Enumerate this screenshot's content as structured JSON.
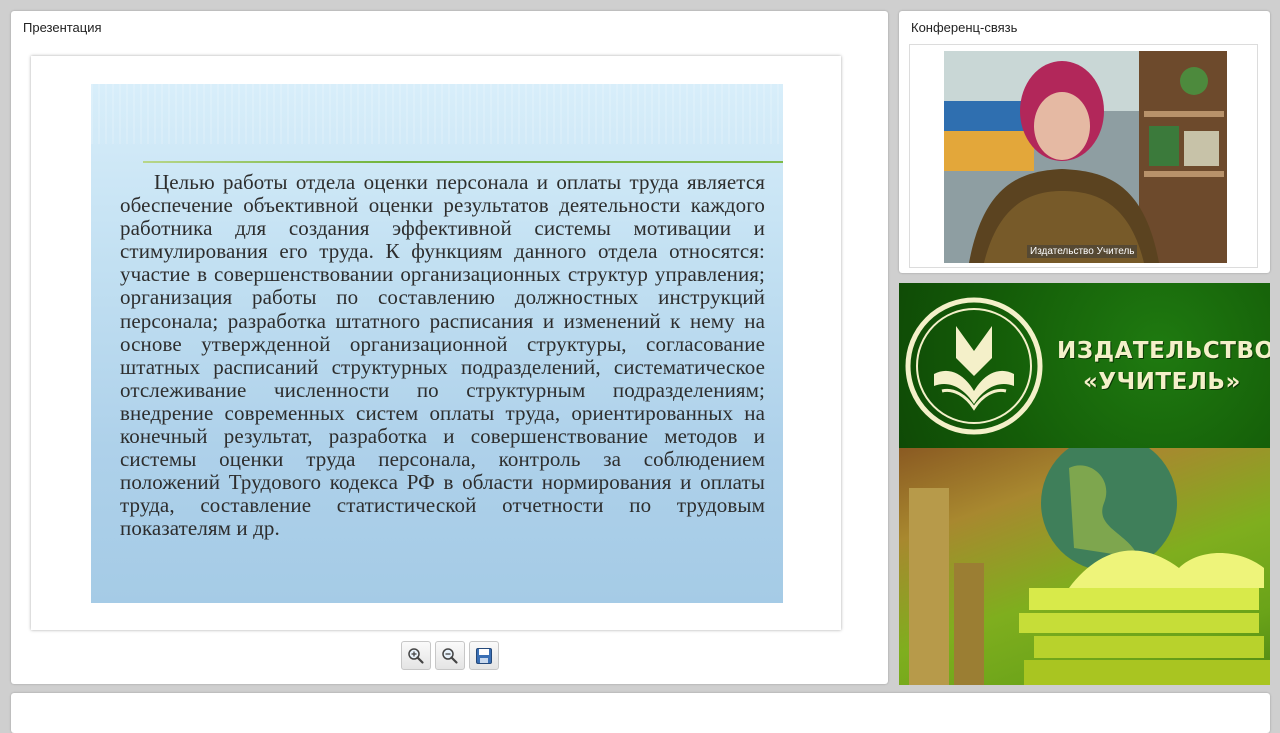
{
  "presentation": {
    "title": "Презентация",
    "slide_text": "Целью работы отдела оценки персонала и оплаты труда является обеспечение объективной оценки результатов деятельности каждого работника для создания эффективной системы мотивации и стимулирования его труда. К функциям данного отдела относятся: участие в совершенствовании организационных структур управления; организация работы по составлению должностных инструкций персонала; разработка штатного расписания и изменений к нему на основе утвержденной организационной структуры, согласование штатных расписаний структурных подразделений, систематическое отслеживание численности по структурным подразделениям; внедрение современных систем оплаты труда, ориентированных на конечный результат, разработка и совершенствование методов и системы оценки труда персонала, контроль за соблюдением положений Трудового кодекса РФ в области нормирования и оплаты труда, составление статистической отчетности по трудовым показателям и др."
  },
  "toolbar": {
    "zoom_in_icon": "zoom-in-icon",
    "zoom_out_icon": "zoom-out-icon",
    "save_icon": "floppy-disk-icon"
  },
  "conference": {
    "title": "Конференц-связь",
    "video_caption": "Издательство Учитель"
  },
  "ad": {
    "name_line1": "ИЗДАТЕЛЬСТВО",
    "name_line2": "«УЧИТЕЛЬ»"
  },
  "colors": {
    "ad_green": "#145c08",
    "ad_text": "#f4f0c9",
    "slide_blue": "#aed1ea"
  }
}
